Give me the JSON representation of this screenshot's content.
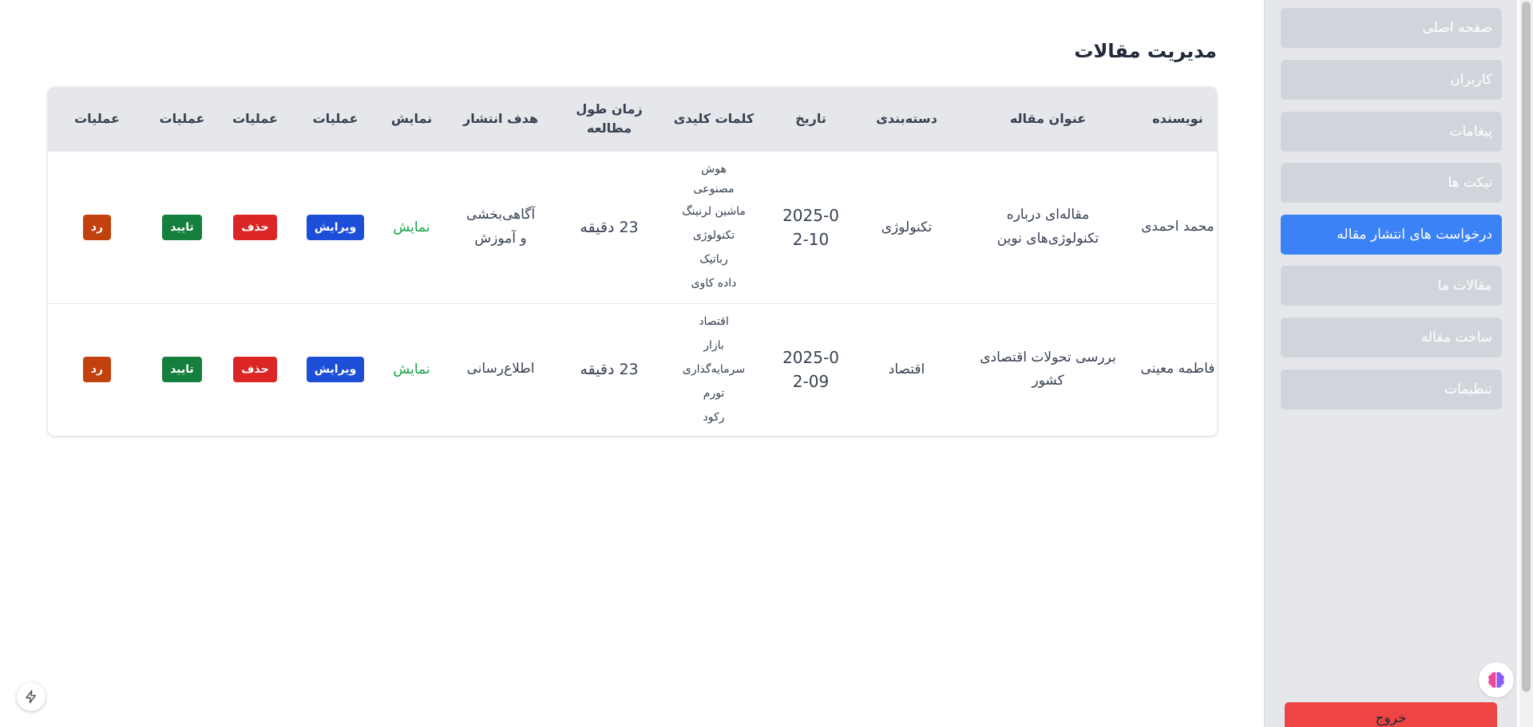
{
  "page": {
    "title": "مدیریت مقالات"
  },
  "sidebar": {
    "items": [
      {
        "label": "صفحه اصلی",
        "active": false
      },
      {
        "label": "کاربران",
        "active": false
      },
      {
        "label": "پیغامات",
        "active": false
      },
      {
        "label": "تیکت ها",
        "active": false
      },
      {
        "label": "درخواست های انتشار مقاله",
        "active": true
      },
      {
        "label": "مقالات ما",
        "active": false
      },
      {
        "label": "ساخت مقاله",
        "active": false
      },
      {
        "label": "تنظیمات",
        "active": false
      }
    ],
    "logout_label": "خروج"
  },
  "table": {
    "headers": [
      "نویسنده",
      "عنوان مقاله",
      "دسته‌بندی",
      "تاریخ",
      "کلمات کلیدی",
      "زمان طول مطالعه",
      "هدف انتشار",
      "نمایش",
      "عملیات",
      "عملیات",
      "عملیات",
      "عملیات"
    ],
    "rows": [
      {
        "author": "محمد احمدی",
        "title": "مقاله‌ای درباره تکنولوژی‌های نوین",
        "category": "تکنولوژی",
        "date": "2025-02-10",
        "keywords": [
          "هوش مصنوعی",
          "ماشین لرنینگ",
          "تکنولوژی",
          "رباتیک",
          "داده کاوی"
        ],
        "read_time": "23 دقیقه",
        "goal": "آگاهی‌بخشی و آموزش",
        "show": "نمایش",
        "edit": "ویرایش",
        "delete": "حذف",
        "approve": "تایید",
        "reject": "رد"
      },
      {
        "author": "فاطمه معینی",
        "title": "بررسی تحولات اقتصادی کشور",
        "category": "اقتصاد",
        "date": "2025-02-09",
        "keywords": [
          "اقتصاد",
          "بازار",
          "سرمایه‌گذاری",
          "تورم",
          "رکود"
        ],
        "read_time": "23 دقیقه",
        "goal": "اطلاع‌رسانی",
        "show": "نمایش",
        "edit": "ویرایش",
        "delete": "حذف",
        "approve": "تایید",
        "reject": "رد"
      }
    ]
  },
  "colors": {
    "active_nav": "#3b82f6",
    "edit": "#1d4ed8",
    "delete": "#dc2626",
    "approve": "#15803d",
    "reject": "#c2410c",
    "show": "#16a34a",
    "logout": "#ef4444"
  }
}
